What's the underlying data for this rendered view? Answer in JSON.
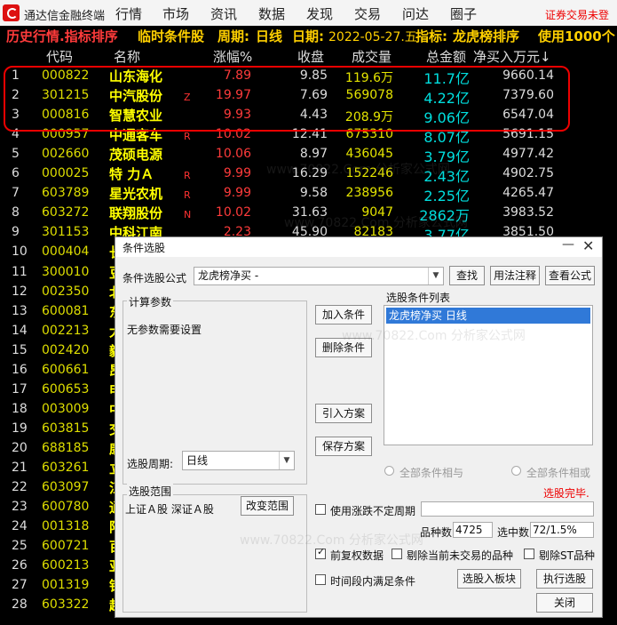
{
  "app": {
    "title": "通达信金融终端",
    "menu": [
      "行情",
      "市场",
      "资讯",
      "数据",
      "发现",
      "交易",
      "问达",
      "圈子"
    ],
    "notice": "证券交易未登"
  },
  "status": {
    "mode": "历史行情.指标排序",
    "temp": "临时条件股",
    "period_label": "周期:",
    "period": "日线",
    "date_label": "日期:",
    "date": "2022-05-27.五",
    "indicator_label": "指标:",
    "indicator": "龙虎榜排序",
    "use": "使用1000个"
  },
  "table": {
    "headers": [
      "代码",
      "名称",
      "涨幅%",
      "收盘",
      "成交量",
      "总金额",
      "净买入万元↓"
    ],
    "rows": [
      {
        "idx": "1",
        "code": "000822",
        "name": "山东海化",
        "flag": "",
        "pct": "7.89",
        "close": "9.85",
        "vol": "119.6万",
        "amt": "11.7亿",
        "net": "9660.14"
      },
      {
        "idx": "2",
        "code": "301215",
        "name": "中汽股份",
        "flag": "Z",
        "pct": "19.97",
        "close": "7.69",
        "vol": "569078",
        "amt": "4.22亿",
        "net": "7379.60"
      },
      {
        "idx": "3",
        "code": "000816",
        "name": "智慧农业",
        "flag": "",
        "pct": "9.93",
        "close": "4.43",
        "vol": "208.9万",
        "amt": "9.06亿",
        "net": "6547.04"
      },
      {
        "idx": "4",
        "code": "000957",
        "name": "中通客车",
        "flag": "R",
        "pct": "10.02",
        "close": "12.41",
        "vol": "675310",
        "amt": "8.07亿",
        "net": "5691.15"
      },
      {
        "idx": "5",
        "code": "002660",
        "name": "茂硕电源",
        "flag": "",
        "pct": "10.06",
        "close": "8.97",
        "vol": "436045",
        "amt": "3.79亿",
        "net": "4977.42"
      },
      {
        "idx": "6",
        "code": "000025",
        "name": "特 力Ａ",
        "flag": "R",
        "pct": "9.99",
        "close": "16.29",
        "vol": "152246",
        "amt": "2.43亿",
        "net": "4902.75"
      },
      {
        "idx": "7",
        "code": "603789",
        "name": "星光农机",
        "flag": "R",
        "pct": "9.99",
        "close": "9.58",
        "vol": "238956",
        "amt": "2.25亿",
        "net": "4265.47"
      },
      {
        "idx": "8",
        "code": "603272",
        "name": "联翔股份",
        "flag": "N",
        "pct": "10.02",
        "close": "31.63",
        "vol": "9047",
        "amt": "2862万",
        "net": "3983.52"
      },
      {
        "idx": "9",
        "code": "301153",
        "name": "中科江南",
        "flag": "",
        "pct": "2.23",
        "close": "45.90",
        "vol": "82183",
        "amt": "3.77亿",
        "net": "3851.50"
      },
      {
        "idx": "10",
        "code": "000404",
        "name": "长",
        "flag": "",
        "pct": "",
        "close": "",
        "vol": "",
        "amt": "",
        "net": ""
      },
      {
        "idx": "11",
        "code": "300010",
        "name": "豆",
        "flag": "",
        "pct": "",
        "close": "",
        "vol": "",
        "amt": "",
        "net": ""
      },
      {
        "idx": "12",
        "code": "002350",
        "name": "北",
        "flag": "",
        "pct": "",
        "close": "",
        "vol": "",
        "amt": "",
        "net": ""
      },
      {
        "idx": "13",
        "code": "600081",
        "name": "东",
        "flag": "",
        "pct": "",
        "close": "",
        "vol": "",
        "amt": "",
        "net": ""
      },
      {
        "idx": "14",
        "code": "002213",
        "name": "大",
        "flag": "",
        "pct": "",
        "close": "",
        "vol": "",
        "amt": "",
        "net": ""
      },
      {
        "idx": "15",
        "code": "002420",
        "name": "毅",
        "flag": "",
        "pct": "",
        "close": "",
        "vol": "",
        "amt": "",
        "net": ""
      },
      {
        "idx": "16",
        "code": "600661",
        "name": "昂",
        "flag": "",
        "pct": "",
        "close": "",
        "vol": "",
        "amt": "",
        "net": ""
      },
      {
        "idx": "17",
        "code": "600653",
        "name": "申",
        "flag": "",
        "pct": "",
        "close": "",
        "vol": "",
        "amt": "",
        "net": ""
      },
      {
        "idx": "18",
        "code": "003009",
        "name": "中",
        "flag": "",
        "pct": "",
        "close": "",
        "vol": "",
        "amt": "",
        "net": ""
      },
      {
        "idx": "19",
        "code": "603815",
        "name": "交",
        "flag": "",
        "pct": "",
        "close": "",
        "vol": "",
        "amt": "",
        "net": ""
      },
      {
        "idx": "20",
        "code": "688185",
        "name": "康",
        "flag": "",
        "pct": "",
        "close": "",
        "vol": "",
        "amt": "",
        "net": ""
      },
      {
        "idx": "21",
        "code": "603261",
        "name": "立",
        "flag": "",
        "pct": "",
        "close": "",
        "vol": "",
        "amt": "",
        "net": ""
      },
      {
        "idx": "22",
        "code": "603097",
        "name": "江",
        "flag": "",
        "pct": "",
        "close": "",
        "vol": "",
        "amt": "",
        "net": ""
      },
      {
        "idx": "23",
        "code": "600780",
        "name": "通",
        "flag": "",
        "pct": "",
        "close": "",
        "vol": "",
        "amt": "",
        "net": ""
      },
      {
        "idx": "24",
        "code": "001318",
        "name": "阳",
        "flag": "",
        "pct": "",
        "close": "",
        "vol": "",
        "amt": "",
        "net": ""
      },
      {
        "idx": "25",
        "code": "600721",
        "name": "百",
        "flag": "",
        "pct": "",
        "close": "",
        "vol": "",
        "amt": "",
        "net": ""
      },
      {
        "idx": "26",
        "code": "600213",
        "name": "亚",
        "flag": "",
        "pct": "",
        "close": "",
        "vol": "",
        "amt": "",
        "net": ""
      },
      {
        "idx": "27",
        "code": "001319",
        "name": "铭",
        "flag": "",
        "pct": "",
        "close": "",
        "vol": "",
        "amt": "",
        "net": ""
      },
      {
        "idx": "28",
        "code": "603322",
        "name": "超",
        "flag": "",
        "pct": "",
        "close": "",
        "vol": "",
        "amt": "",
        "net": ""
      }
    ]
  },
  "dialog": {
    "title": "条件选股",
    "formula_label": "条件选股公式",
    "formula_value": "龙虎榜净买   -",
    "find": "查找",
    "usage": "用法注释",
    "view": "查看公式",
    "calc_params": "计算参数",
    "no_params": "无参数需要设置",
    "add_cond": "加入条件",
    "del_cond": "删除条件",
    "import_plan": "引入方案",
    "save_plan": "保存方案",
    "list_label": "选股条件列表",
    "list_items": [
      "龙虎榜净买  日线"
    ],
    "period_label": "选股周期:",
    "period_value": "日线",
    "all_and": "全部条件相与",
    "all_or": "全部条件相或",
    "done": "选股完毕.",
    "range_label": "选股范围",
    "range_value": "上证Ａ股 深证Ａ股",
    "change_range": "改变范围",
    "use_unfixed": "使用涨跌不定周期",
    "count_label": "品种数",
    "count_value": "4725",
    "selected_label": "选中数",
    "selected_value": "72/1.5%",
    "pre_adjust": "前复权数据",
    "exclude_untraded": "剔除当前未交易的品种",
    "exclude_st": "剔除ST品种",
    "time_range": "时间段内满足条件",
    "to_block": "选股入板块",
    "execute": "执行选股",
    "close": "关闭"
  },
  "watermark": "www.70822.Com 分析家公式网"
}
